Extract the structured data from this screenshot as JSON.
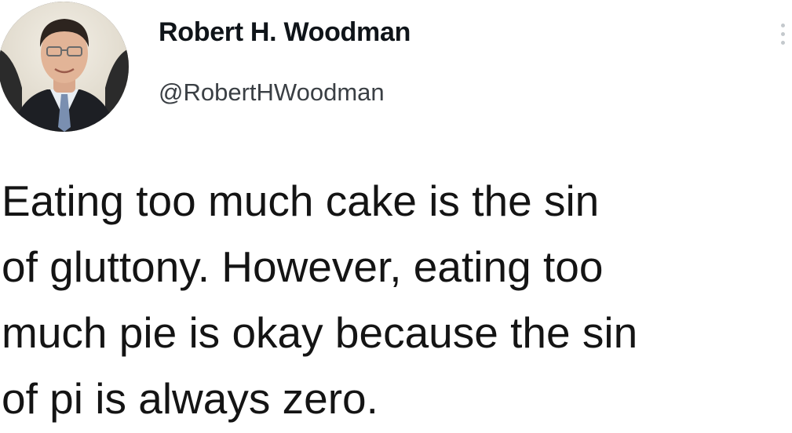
{
  "author": {
    "display_name": "Robert H. Woodman",
    "handle": "@RobertHWoodman",
    "avatar_icon": "profile-photo"
  },
  "menu_icon": "more-options-icon",
  "tweet": {
    "lines": [
      "Eating too much cake is the sin",
      "of gluttony. However, eating too",
      "much pie is okay because the sin",
      "of pi is always zero."
    ]
  }
}
